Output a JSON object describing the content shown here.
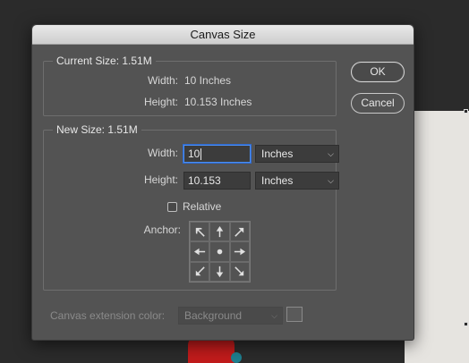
{
  "dialog": {
    "title": "Canvas Size",
    "ok_label": "OK",
    "cancel_label": "Cancel"
  },
  "current_size": {
    "legend": "Current Size: 1.51M",
    "width_label": "Width:",
    "width_value": "10 Inches",
    "height_label": "Height:",
    "height_value": "10.153 Inches"
  },
  "new_size": {
    "legend": "New Size: 1.51M",
    "width_label": "Width:",
    "width_value": "10",
    "width_unit": "Inches",
    "height_label": "Height:",
    "height_value": "10.153",
    "height_unit": "Inches",
    "relative_label": "Relative",
    "relative_checked": false,
    "anchor_label": "Anchor:",
    "anchor_cells": [
      "arrow-up-left-icon",
      "arrow-up-icon",
      "arrow-up-right-icon",
      "arrow-left-icon",
      "anchor-center-dot-icon",
      "arrow-right-icon",
      "arrow-down-left-icon",
      "arrow-down-icon",
      "arrow-down-right-icon"
    ]
  },
  "extension": {
    "label": "Canvas extension color:",
    "value": "Background"
  }
}
